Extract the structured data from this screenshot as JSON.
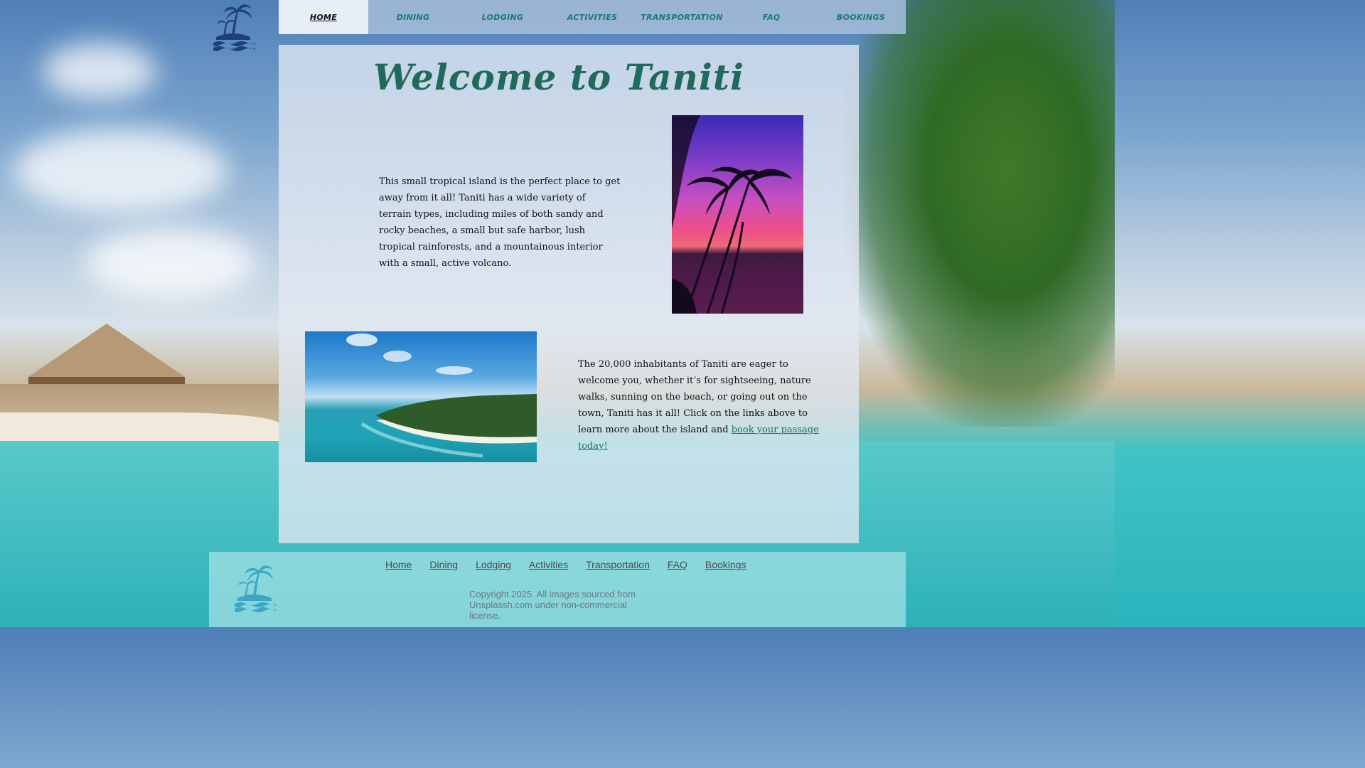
{
  "nav": {
    "items": [
      {
        "label": "HOME",
        "active": true
      },
      {
        "label": "DINING",
        "active": false
      },
      {
        "label": "LODGING",
        "active": false
      },
      {
        "label": "ACTIVITIES",
        "active": false
      },
      {
        "label": "TRANSPORTATION",
        "active": false
      },
      {
        "label": "FAQ",
        "active": false
      },
      {
        "label": "BOOKINGS",
        "active": false
      }
    ]
  },
  "main": {
    "title": "Welcome to Taniti",
    "paragraph1": "This small tropical island is the perfect place to get away from it all! Taniti has a wide variety of terrain types, including miles of both sandy and rocky beaches, a small but safe harbor, lush tropical rainforests, and a mountainous interior with a small, active volcano.",
    "paragraph2": "The 20,000 inhabitants of Taniti are eager to welcome you, whether it’s for sightseeing, nature walks, sunning on the beach, or going out on the town, Taniti has it all! Click on the links above to learn more about the island and ",
    "booking_link": "book your passage today!"
  },
  "footer": {
    "links": [
      "Home",
      "Dining",
      "Lodging",
      "Activities",
      "Transportation",
      "FAQ",
      "Bookings"
    ],
    "copyright": "Copyright 2025. All images sourced from Unsplassh.com under non-commercial license."
  },
  "colors": {
    "accent": "#1b7a6e",
    "logo": "#1e3f7c",
    "footer_logo": "#3aa5c6"
  },
  "icons": {
    "logo": "palm-island-icon"
  }
}
